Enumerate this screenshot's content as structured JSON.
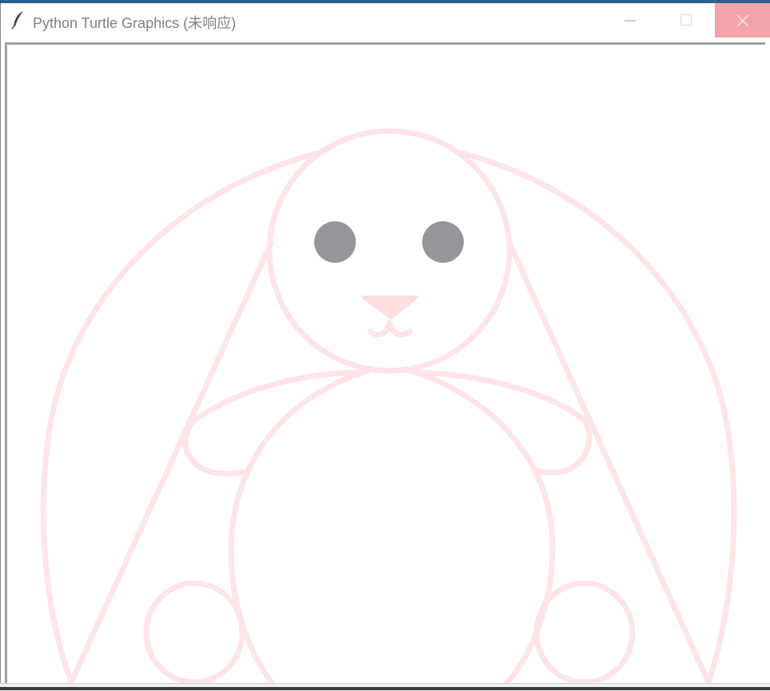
{
  "window": {
    "title": "Python Turtle Graphics (未响应)",
    "icon": "feather-icon",
    "controls": {
      "minimize": "minimize-icon",
      "maximize": "maximize-icon",
      "close": "close-icon"
    }
  },
  "canvas": {
    "background": "#ffffff",
    "stroke_color": "#fee4e6",
    "eye_color": "#96969a",
    "nose_color": "#ffdde0",
    "subject": "bunny-drawing"
  },
  "colors": {
    "close_hover": "#f4a3ab",
    "title_text": "#808080",
    "frame_border": "#a0a0a0"
  }
}
